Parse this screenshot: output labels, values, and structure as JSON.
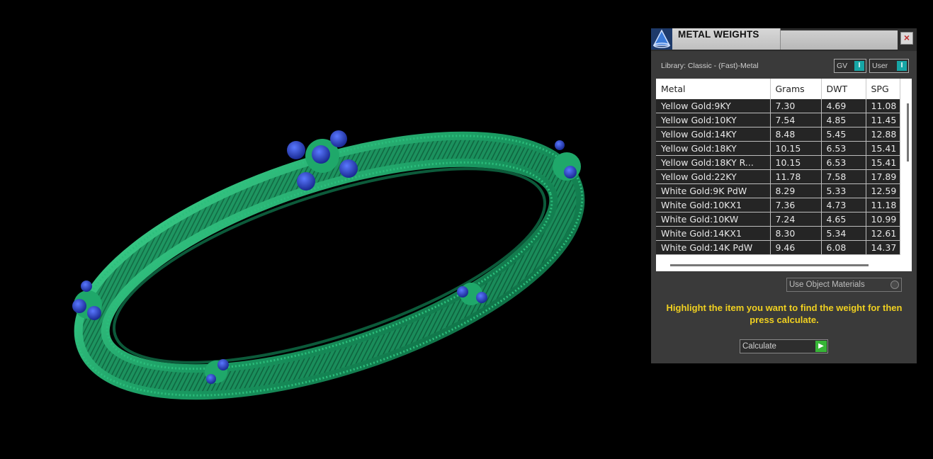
{
  "panel": {
    "title": "METAL WEIGHTS",
    "close_label": "×",
    "library_label": "Library: Classic - (Fast)-Metal",
    "toggle_gv": "GV",
    "toggle_user": "User",
    "toggle_knob": "I",
    "columns": [
      "Metal",
      "Grams",
      "DWT",
      "SPG"
    ],
    "rows": [
      [
        "Yellow Gold:9KY",
        "7.30",
        "4.69",
        "11.08"
      ],
      [
        "Yellow Gold:10KY",
        "7.54",
        "4.85",
        "11.45"
      ],
      [
        "Yellow Gold:14KY",
        "8.48",
        "5.45",
        "12.88"
      ],
      [
        "Yellow Gold:18KY",
        "10.15",
        "6.53",
        "15.41"
      ],
      [
        "Yellow Gold:18KY R...",
        "10.15",
        "6.53",
        "15.41"
      ],
      [
        "Yellow Gold:22KY",
        "11.78",
        "7.58",
        "17.89"
      ],
      [
        "White Gold:9K PdW",
        "8.29",
        "5.33",
        "12.59"
      ],
      [
        "White Gold:10KX1",
        "7.36",
        "4.73",
        "11.18"
      ],
      [
        "White Gold:10KW",
        "7.24",
        "4.65",
        "10.99"
      ],
      [
        "White Gold:14KX1",
        "8.30",
        "5.34",
        "12.61"
      ],
      [
        "White Gold:14K PdW",
        "9.46",
        "6.08",
        "14.37"
      ]
    ],
    "use_object_materials": "Use Object Materials",
    "hint": "Highlight the item you want to find the weight for then press calculate.",
    "calculate_label": "Calculate",
    "colors": {
      "accent_toggle": "#17a6a6",
      "hint": "#f0d020",
      "go": "#37b537",
      "bangle": "#1fa86a",
      "gem": "#1f3fc8"
    }
  }
}
